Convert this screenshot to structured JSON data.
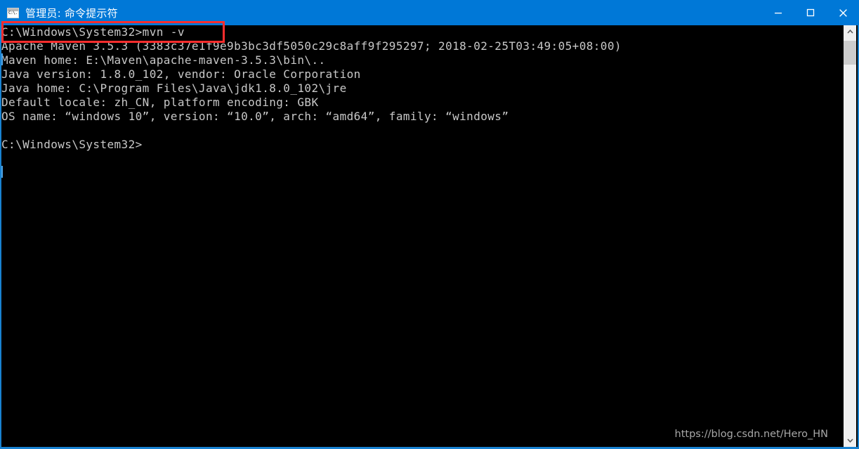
{
  "window": {
    "title": "管理员: 命令提示符",
    "icon": "cmd-icon",
    "controls": {
      "minimize": "minimize-icon",
      "maximize": "maximize-icon",
      "close": "close-icon"
    },
    "accent_color": "#0078d7",
    "background_color": "#000000",
    "text_color": "#c8c8c8"
  },
  "console": {
    "lines": [
      "C:\\Windows\\System32>mvn -v",
      "Apache Maven 3.5.3 (3383c37e1f9e9b3bc3df5050c29c8aff9f295297; 2018-02-25T03:49:05+08:00)",
      "Maven home: E:\\Maven\\apache-maven-3.5.3\\bin\\..",
      "Java version: 1.8.0_102, vendor: Oracle Corporation",
      "Java home: C:\\Program Files\\Java\\jdk1.8.0_102\\jre",
      "Default locale: zh_CN, platform encoding: GBK",
      "OS name: “windows 10”, version: “10.0”, arch: “amd64”, family: “windows”",
      "",
      "C:\\Windows\\System32>"
    ],
    "command": "mvn -v",
    "prompt": "C:\\Windows\\System32>"
  },
  "annotation": {
    "highlight_color": "#ff2d2d",
    "highlight_target": "C:\\Windows\\System32>mvn -v"
  },
  "watermark": {
    "text": "https://blog.csdn.net/Hero_HN"
  },
  "scrollbar": {
    "up_arrow": "chevron-up-icon",
    "down_arrow": "chevron-down-icon",
    "thumb": "scrollbar-thumb"
  }
}
